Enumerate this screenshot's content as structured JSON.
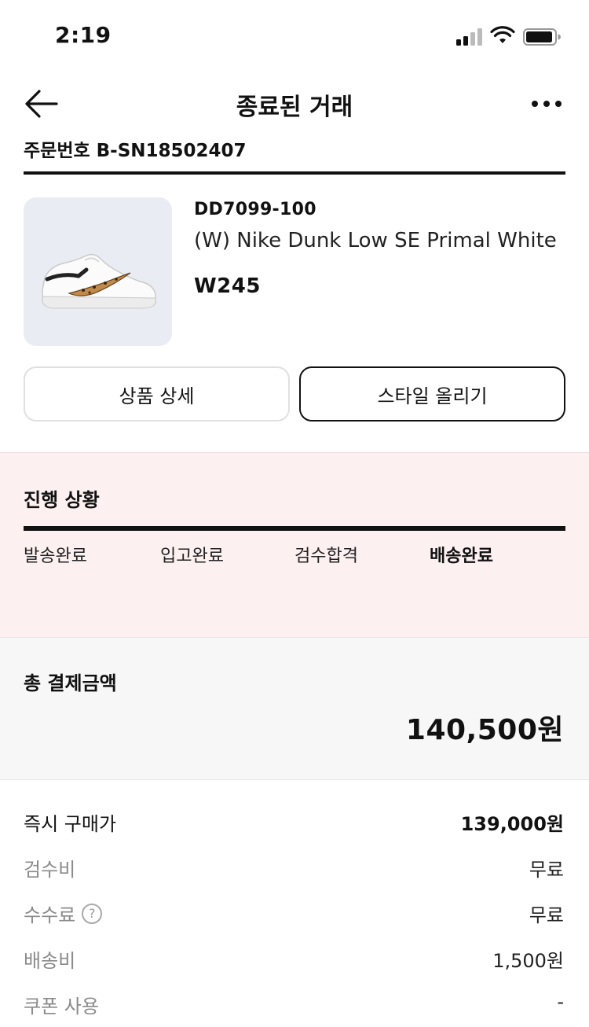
{
  "status_bar": {
    "time": "2:19"
  },
  "header": {
    "title": "종료된 거래"
  },
  "order": {
    "prefix": "주문번호",
    "number": "B-SN18502407"
  },
  "product": {
    "code": "DD7099-100",
    "name": "(W) Nike Dunk Low SE Primal White",
    "size": "W245"
  },
  "actions": {
    "detail_label": "상품 상세",
    "style_label": "스타일 올리기"
  },
  "progress": {
    "title": "진행 상황",
    "steps": [
      "발송완료",
      "입고완료",
      "검수합격",
      "배송완료"
    ],
    "current_step": "배송완료",
    "completion": 1.0
  },
  "total": {
    "label": "총 결제금액",
    "amount": "140,500원"
  },
  "breakdown": [
    {
      "label": "즉시 구매가",
      "value": "139,000원"
    },
    {
      "label": "검수비",
      "value": "무료"
    },
    {
      "label": "수수료",
      "value": "무료"
    },
    {
      "label": "배송비",
      "value": "1,500원"
    },
    {
      "label": "쿠폰 사용",
      "value": "-"
    }
  ],
  "colors": {
    "progress_bg": "#fcf0f0",
    "total_bg": "#f7f7f7",
    "thumb_bg": "#e9edf3"
  }
}
